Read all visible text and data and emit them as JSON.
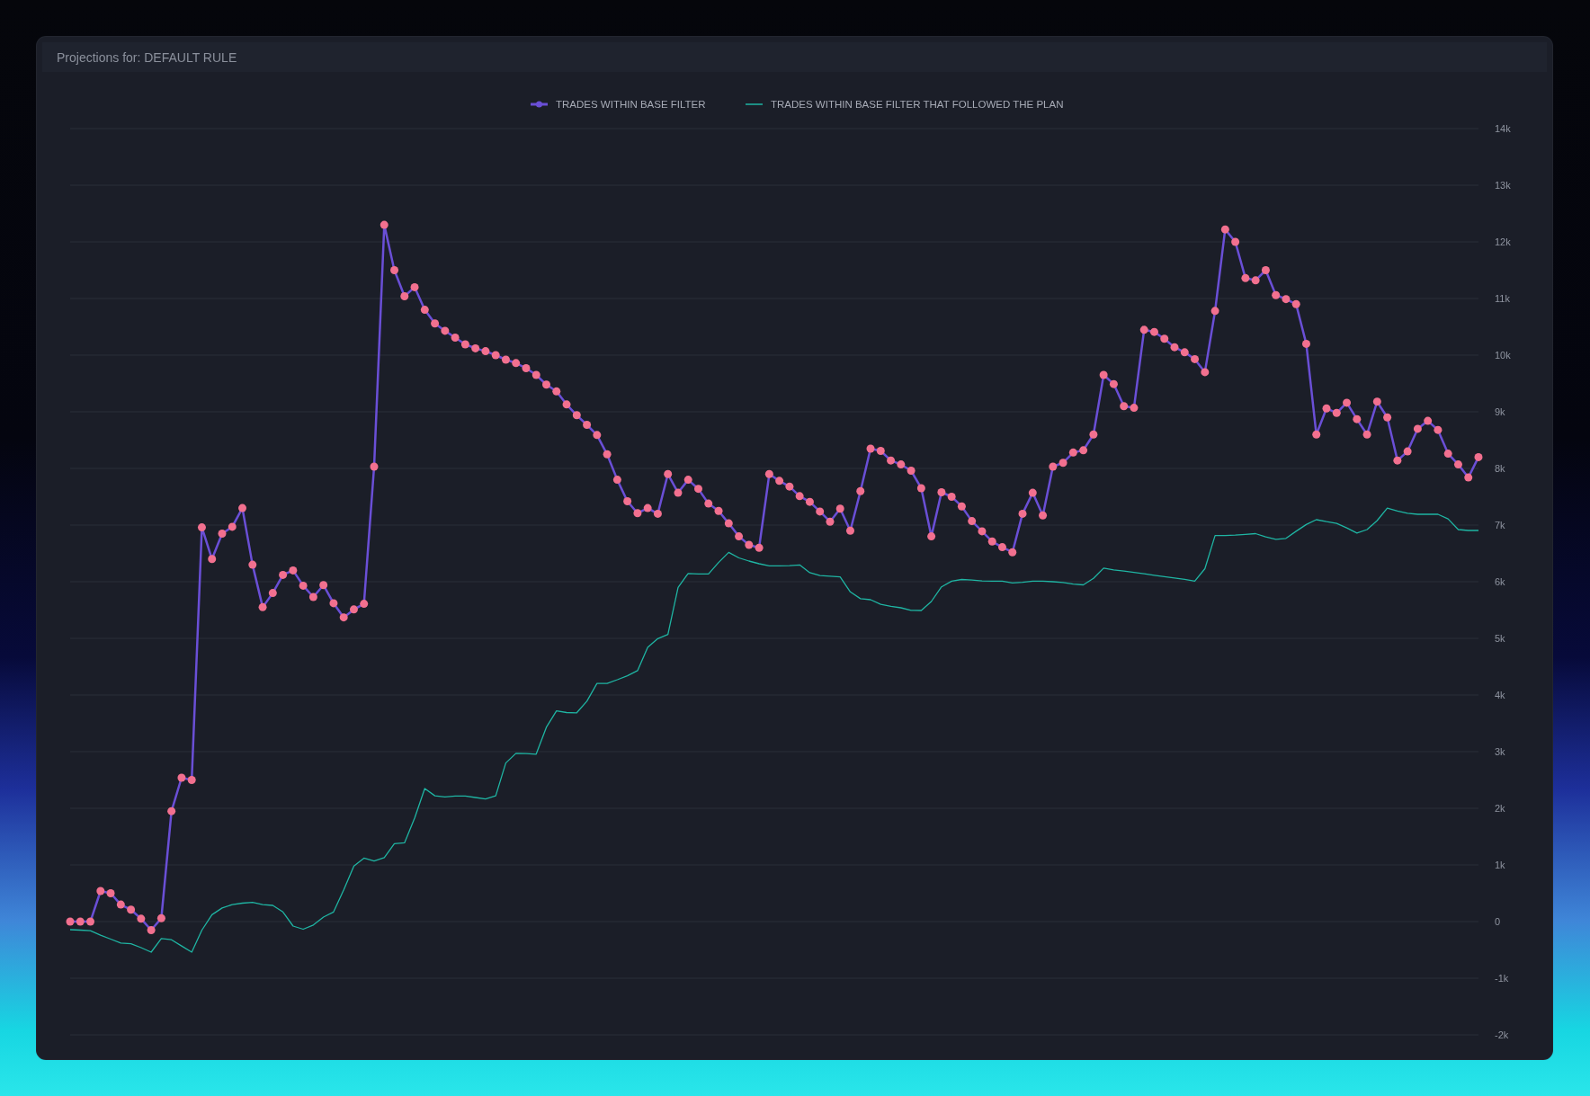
{
  "panel": {
    "title": "Projections for: DEFAULT RULE",
    "chart_data": {
      "type": "line",
      "ylim": [
        -2000,
        14000
      ],
      "grid": true,
      "legend": true,
      "categories": [
        null,
        null,
        null,
        null,
        null,
        null,
        null,
        null,
        null,
        null,
        null,
        null,
        null,
        null,
        null,
        null,
        null,
        null,
        null,
        null,
        null,
        null,
        null,
        null,
        null,
        null,
        null,
        null,
        null,
        null,
        null,
        null,
        null,
        null,
        null,
        null,
        null,
        null,
        null,
        null,
        null,
        null,
        null,
        null,
        null,
        null,
        null,
        null,
        null,
        null,
        null,
        null,
        null,
        null,
        null,
        null,
        null,
        null,
        null,
        null,
        null,
        null,
        null,
        null,
        null,
        null,
        null,
        null,
        null,
        null,
        null,
        null,
        null,
        null,
        null,
        null,
        null,
        null,
        null,
        null,
        null,
        null,
        null,
        null,
        null,
        null,
        null,
        null,
        null,
        null,
        null,
        null,
        null,
        null,
        null,
        null,
        null,
        null,
        null,
        null,
        null,
        null,
        null,
        null,
        null,
        null,
        null,
        null,
        null,
        null,
        null,
        null,
        null,
        null,
        null,
        null,
        null,
        null,
        null,
        null,
        null,
        null,
        null,
        null,
        null,
        null,
        null,
        null,
        null,
        null,
        null,
        null,
        null,
        null,
        null,
        null,
        null,
        null,
        null,
        null
      ],
      "yticks": [
        {
          "value": 14000,
          "label": "14k"
        },
        {
          "value": 13000,
          "label": "13k"
        },
        {
          "value": 12000,
          "label": "12k"
        },
        {
          "value": 11000,
          "label": "11k"
        },
        {
          "value": 10000,
          "label": "10k"
        },
        {
          "value": 9000,
          "label": "9k"
        },
        {
          "value": 8000,
          "label": "8k"
        },
        {
          "value": 7000,
          "label": "7k"
        },
        {
          "value": 6000,
          "label": "6k"
        },
        {
          "value": 5000,
          "label": "5k"
        },
        {
          "value": 4000,
          "label": "4k"
        },
        {
          "value": 3000,
          "label": "3k"
        },
        {
          "value": 2000,
          "label": "2k"
        },
        {
          "value": 1000,
          "label": "1k"
        },
        {
          "value": 0,
          "label": "0"
        },
        {
          "value": -1000,
          "label": "-1k"
        },
        {
          "value": -2000,
          "label": "-2k"
        }
      ],
      "series": [
        {
          "name": "TRADES WITHIN BASE FILTER",
          "color": "#6a4fd6",
          "marker": true,
          "values": [
            0,
            0,
            0,
            540,
            500,
            300,
            210,
            50,
            -150,
            60,
            1950,
            2540,
            2500,
            6959,
            6400,
            6850,
            6970,
            7300,
            6300,
            5550,
            5800,
            6120,
            6200,
            5930,
            5730,
            5940,
            5620,
            5370,
            5510,
            5610,
            8032,
            12300,
            11500,
            11040,
            11200,
            10800,
            10560,
            10430,
            10310,
            10190,
            10120,
            10070,
            10000,
            9920,
            9860,
            9770,
            9650,
            9480,
            9360,
            9130,
            8940,
            8770,
            8590,
            8250,
            7800,
            7420,
            7210,
            7300,
            7200,
            7900,
            7570,
            7800,
            7640,
            7380,
            7250,
            7030,
            6800,
            6650,
            6600,
            7900,
            7780,
            7680,
            7510,
            7410,
            7240,
            7060,
            7290,
            6900,
            7600,
            8350,
            8310,
            8140,
            8070,
            7960,
            7650,
            6800,
            7580,
            7500,
            7330,
            7070,
            6890,
            6710,
            6610,
            6520,
            7200,
            7570,
            7170,
            8032,
            8100,
            8280,
            8320,
            8600,
            9650,
            9490,
            9100,
            9070,
            10447,
            10410,
            10290,
            10140,
            10050,
            9930,
            9700,
            10780,
            12220,
            12000,
            11360,
            11320,
            11500,
            11060,
            10990,
            10900,
            10200,
            8600,
            9060,
            8980,
            9160,
            8870,
            8600,
            9180,
            8900,
            8140,
            8300,
            8700,
            8840,
            8680,
            8260,
            8070,
            7840,
            8200
          ]
        },
        {
          "name": "TRADES WITHIN BASE FILTER THAT FOLLOWED THE PLAN",
          "color": "#1fb5a3",
          "values": [
            -143,
            -150,
            -160,
            -240,
            -310,
            -378,
            -390,
            -460,
            -540,
            -300,
            -320,
            -430,
            -540,
            -150,
            120,
            240,
            300,
            325,
            338,
            300,
            286,
            170,
            -80,
            -135,
            -60,
            80,
            170,
            560,
            980,
            1120,
            1070,
            1130,
            1375,
            1390,
            1830,
            2350,
            2220,
            2200,
            2218,
            2218,
            2190,
            2165,
            2220,
            2800,
            2970,
            2965,
            2955,
            3430,
            3720,
            3690,
            3685,
            3890,
            4204,
            4204,
            4270,
            4340,
            4430,
            4840,
            4995,
            5070,
            5900,
            6146,
            6136,
            6136,
            6340,
            6517,
            6420,
            6365,
            6318,
            6280,
            6279,
            6282,
            6297,
            6160,
            6110,
            6098,
            6084,
            5820,
            5700,
            5682,
            5600,
            5565,
            5540,
            5496,
            5492,
            5650,
            5910,
            6010,
            6040,
            6028,
            6015,
            6011,
            6010,
            5980,
            5990,
            6011,
            6011,
            6000,
            5985,
            5957,
            5945,
            6060,
            6240,
            6210,
            6187,
            6163,
            6140,
            6115,
            6090,
            6066,
            6042,
            6010,
            6230,
            6816,
            6816,
            6822,
            6835,
            6850,
            6790,
            6750,
            6765,
            6890,
            7010,
            7096,
            7060,
            7030,
            6950,
            6860,
            6920,
            7080,
            7300,
            7250,
            7210,
            7191,
            7191,
            7191,
            7110,
            6920,
            6905,
            6905
          ]
        }
      ]
    }
  }
}
